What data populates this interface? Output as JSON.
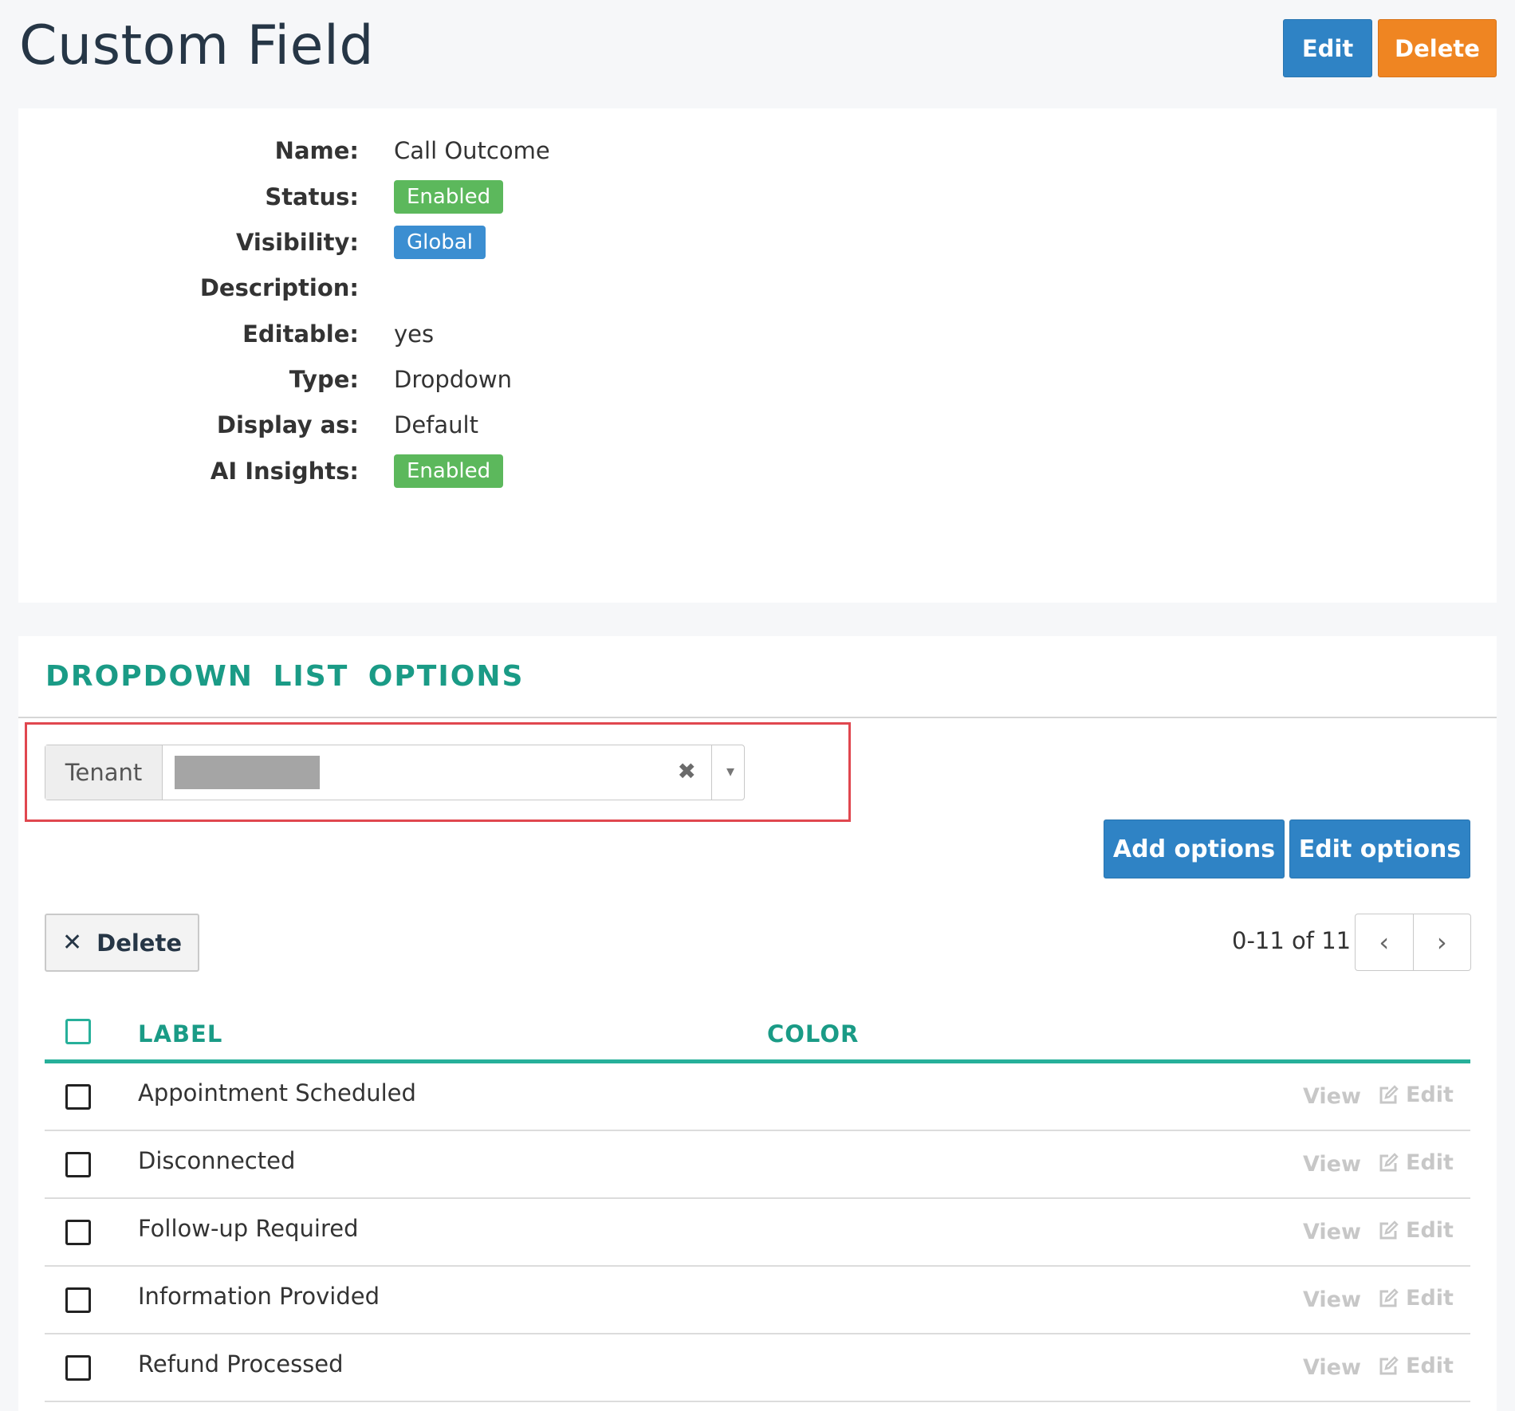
{
  "page": {
    "title": "Custom Field",
    "edit_label": "Edit",
    "delete_label": "Delete"
  },
  "details": {
    "rows": [
      {
        "label": "Name:",
        "value": "Call Outcome",
        "kind": "text"
      },
      {
        "label": "Status:",
        "value": "Enabled",
        "kind": "badge-green"
      },
      {
        "label": "Visibility:",
        "value": "Global",
        "kind": "badge-blue"
      },
      {
        "label": "Description:",
        "value": "",
        "kind": "text"
      },
      {
        "label": "Editable:",
        "value": "yes",
        "kind": "text"
      },
      {
        "label": "Type:",
        "value": "Dropdown",
        "kind": "text"
      },
      {
        "label": "Display as:",
        "value": "Default",
        "kind": "text"
      },
      {
        "label": "AI Insights:",
        "value": "Enabled",
        "kind": "badge-green"
      }
    ]
  },
  "options_section": {
    "title": "DROPDOWN LIST OPTIONS",
    "tenant_label": "Tenant",
    "clear_glyph": "✖",
    "caret_glyph": "▾",
    "add_options_label": "Add options",
    "edit_options_label": "Edit options",
    "delete_selected_label": "Delete",
    "delete_selected_glyph": "✕",
    "pager": {
      "text": "0-11 of 11",
      "prev_glyph": "‹",
      "next_glyph": "›"
    },
    "table": {
      "columns": {
        "label": "LABEL",
        "color": "COLOR"
      },
      "view_label": "View",
      "edit_label": "Edit",
      "rows": [
        {
          "label": "Appointment Scheduled"
        },
        {
          "label": "Disconnected"
        },
        {
          "label": "Follow-up Required"
        },
        {
          "label": "Information Provided"
        },
        {
          "label": "Refund Processed"
        }
      ]
    }
  },
  "colors": {
    "primary_blue": "#2f83c5",
    "delete_orange": "#ef8522",
    "accent_teal": "#1a9b86",
    "badge_green": "#5cb85c",
    "badge_blue": "#3b8ed1",
    "highlight_red": "#e0474f"
  }
}
